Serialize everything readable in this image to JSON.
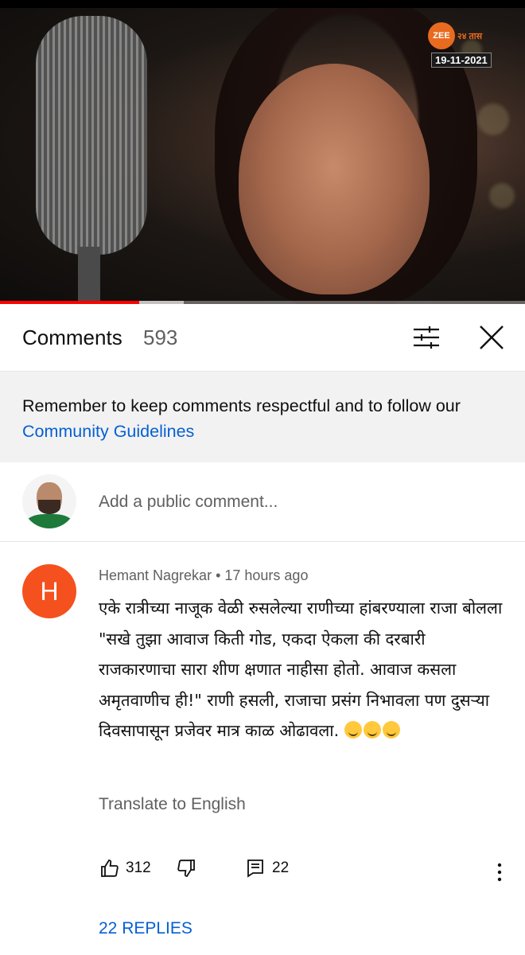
{
  "video": {
    "channel_logo": "ZEE 24 तास",
    "logo_short": "ZEE",
    "logo_rest": "२४ तास",
    "date_stamp": "19-11-2021",
    "progress_played_fraction": 0.265,
    "progress_buffered_fraction": 0.35,
    "accent_color": "#ff0000"
  },
  "comments_panel": {
    "title": "Comments",
    "count": "593",
    "filter_icon": "sort-filter-icon",
    "close_icon": "close-icon",
    "notice_text": "Remember to keep comments respectful and to follow our ",
    "notice_link": "Community Guidelines",
    "add_comment_placeholder": "Add a public comment..."
  },
  "comment": {
    "avatar_letter": "H",
    "avatar_color": "#f4511e",
    "author": "Hemant Nagrekar",
    "separator": " • ",
    "time": "17 hours ago",
    "text": "एके रात्रीच्या नाजूक वेळी रुसलेल्या राणीच्या हांबरण्याला राजा बोलला \"सखे तुझा आवाज किती गोड, एकदा ऐकला की दरबारी राजकारणाचा सारा शीण क्षणात नाहीसा होतो. आवाज कसला अमृतवाणीच ही!\" राणी हसली, राजाचा प्रसंग निभावला पण दुसऱ्या दिवसापासून प्रजेवर मात्र काळ ओढावला.",
    "emojis": [
      "grinning-squinting-emoji",
      "grinning-emoji",
      "rofl-emoji"
    ],
    "translate_label": "Translate to English",
    "likes": "312",
    "reply_count": "22",
    "replies_label": "22 REPLIES",
    "link_color": "#065fd4"
  }
}
